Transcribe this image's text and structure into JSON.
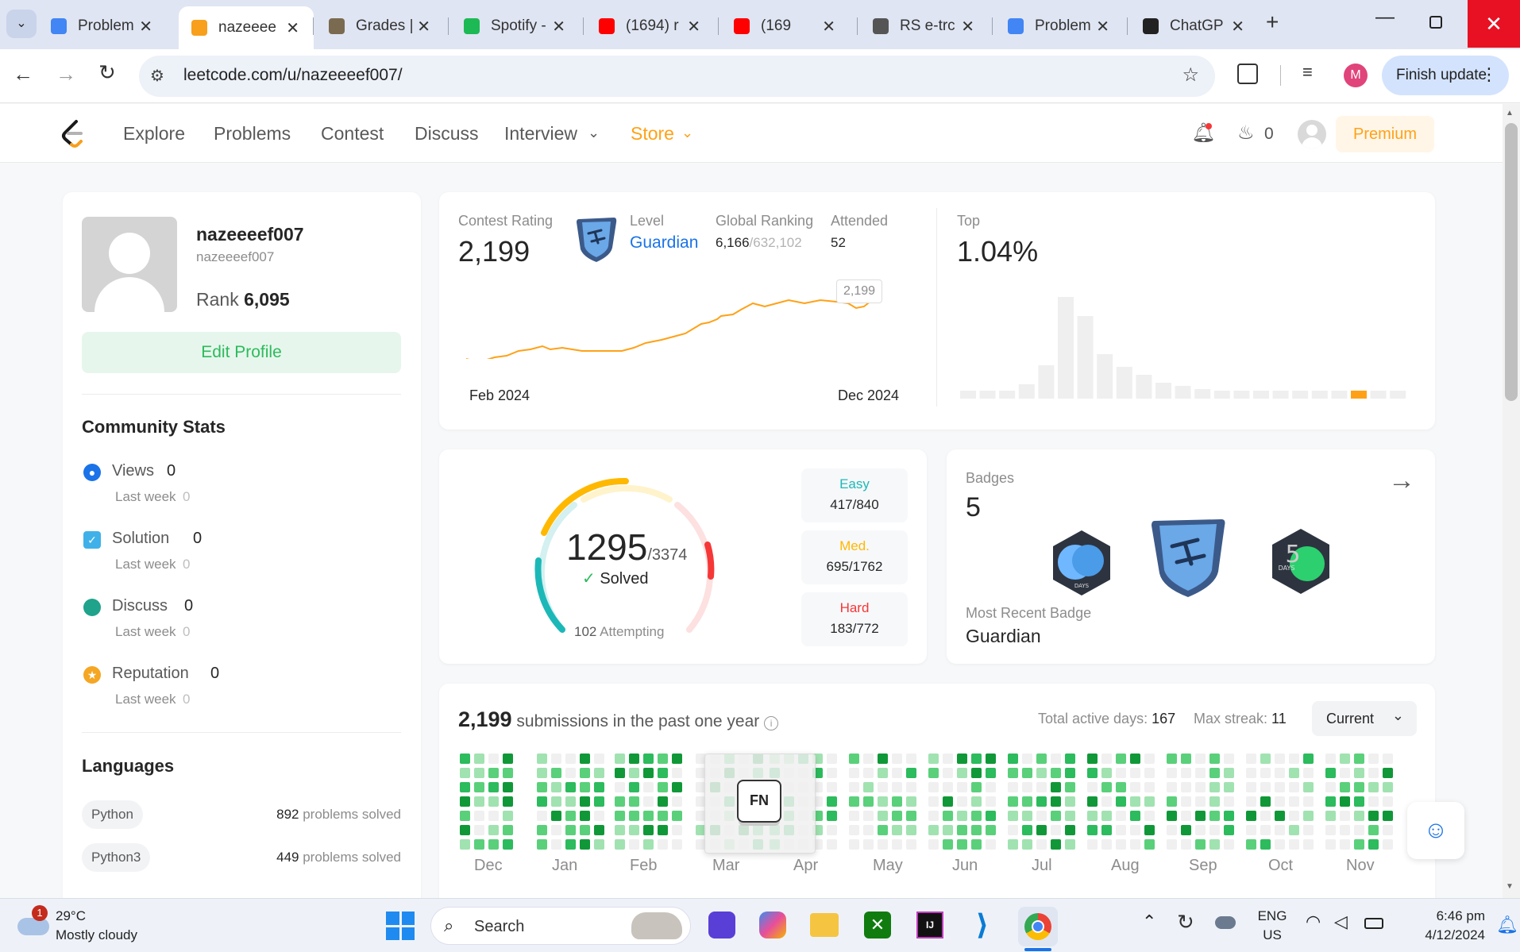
{
  "browser": {
    "tabs": [
      {
        "title": "Problem",
        "icon": "bar-chart-icon",
        "color": "#4285f4"
      },
      {
        "title": "nazeeee",
        "icon": "leetcode-icon",
        "color": "#f89f1b"
      },
      {
        "title": "Grades |",
        "icon": "crest-icon",
        "color": "#7a6a4f"
      },
      {
        "title": "Spotify -",
        "icon": "spotify-icon",
        "color": "#1db954"
      },
      {
        "title": "(1694) r",
        "icon": "youtube-icon",
        "color": "#ff0000"
      },
      {
        "title": "(169",
        "icon": "youtube-icon",
        "color": "#ff0000"
      },
      {
        "title": "RS e-trc",
        "icon": "rs-icon",
        "color": "#555555"
      },
      {
        "title": "Problem",
        "icon": "bar-chart-icon",
        "color": "#4285f4"
      },
      {
        "title": "ChatGP",
        "icon": "chatgpt-icon",
        "color": "#222222"
      }
    ],
    "url": "leetcode.com/u/nazeeeef007/",
    "finish_update": "Finish update",
    "profile_initial": "M"
  },
  "nav": {
    "items": [
      "Explore",
      "Problems",
      "Contest",
      "Discuss",
      "Interview"
    ],
    "store": "Store",
    "streak": "0",
    "premium": "Premium"
  },
  "profile": {
    "display_name": "nazeeeef007",
    "username": "nazeeeef007",
    "rank_label": "Rank",
    "rank": "6,095",
    "edit_button": "Edit Profile"
  },
  "community": {
    "title": "Community Stats",
    "items": [
      {
        "label": "Views",
        "value": "0",
        "sub": "Last week",
        "sub_value": "0",
        "icon": "eye-icon",
        "color": "#1a73e8"
      },
      {
        "label": "Solution",
        "value": "0",
        "sub": "Last week",
        "sub_value": "0",
        "icon": "checkbox-icon",
        "color": "#3fb1e8"
      },
      {
        "label": "Discuss",
        "value": "0",
        "sub": "Last week",
        "sub_value": "0",
        "icon": "chat-bubble-icon",
        "color": "#1fa38b"
      },
      {
        "label": "Reputation",
        "value": "0",
        "sub": "Last week",
        "sub_value": "0",
        "icon": "star-icon",
        "color": "#f5a623"
      }
    ]
  },
  "languages": {
    "title": "Languages",
    "items": [
      {
        "name": "Python",
        "count": "892",
        "suffix": "problems solved"
      },
      {
        "name": "Python3",
        "count": "449",
        "suffix": "problems solved"
      }
    ]
  },
  "contest": {
    "rating_label": "Contest Rating",
    "rating": "2,199",
    "level_label": "Level",
    "level": "Guardian",
    "global_label": "Global Ranking",
    "global_rank": "6,166",
    "global_total": "/632,102",
    "attended_label": "Attended",
    "attended": "52",
    "top_label": "Top",
    "top": "1.04%",
    "tooltip": "2,199",
    "x_start": "Feb 2024",
    "x_end": "Dec 2024"
  },
  "solved": {
    "count": "1295",
    "total": "/3374",
    "solved_label": "Solved",
    "attempting_count": "102",
    "attempting_label": "Attempting",
    "easy_label": "Easy",
    "easy": "417/840",
    "easy_color": "#1cb8b8",
    "med_label": "Med.",
    "med": "695/1762",
    "med_color": "#ffb800",
    "hard_label": "Hard",
    "hard": "183/772",
    "hard_color": "#f63737"
  },
  "badges": {
    "label": "Badges",
    "count": "5",
    "recent_label": "Most Recent Badge",
    "recent": "Guardian"
  },
  "submissions": {
    "count": "2,199",
    "text": "submissions in the past one year",
    "active_label": "Total active days:",
    "active": "167",
    "streak_label": "Max streak:",
    "streak": "11",
    "select": "Current",
    "months": [
      "Dec",
      "Jan",
      "Feb",
      "Mar",
      "Apr",
      "May",
      "Jun",
      "Jul",
      "Aug",
      "Sep",
      "Oct",
      "Nov"
    ],
    "overlay_key": "FN"
  },
  "taskbar": {
    "weather_badge": "1",
    "temp": "29°C",
    "weather": "Mostly cloudy",
    "search": "Search",
    "lang1": "ENG",
    "lang2": "US",
    "time": "6:46 pm",
    "date": "4/12/2024"
  }
}
